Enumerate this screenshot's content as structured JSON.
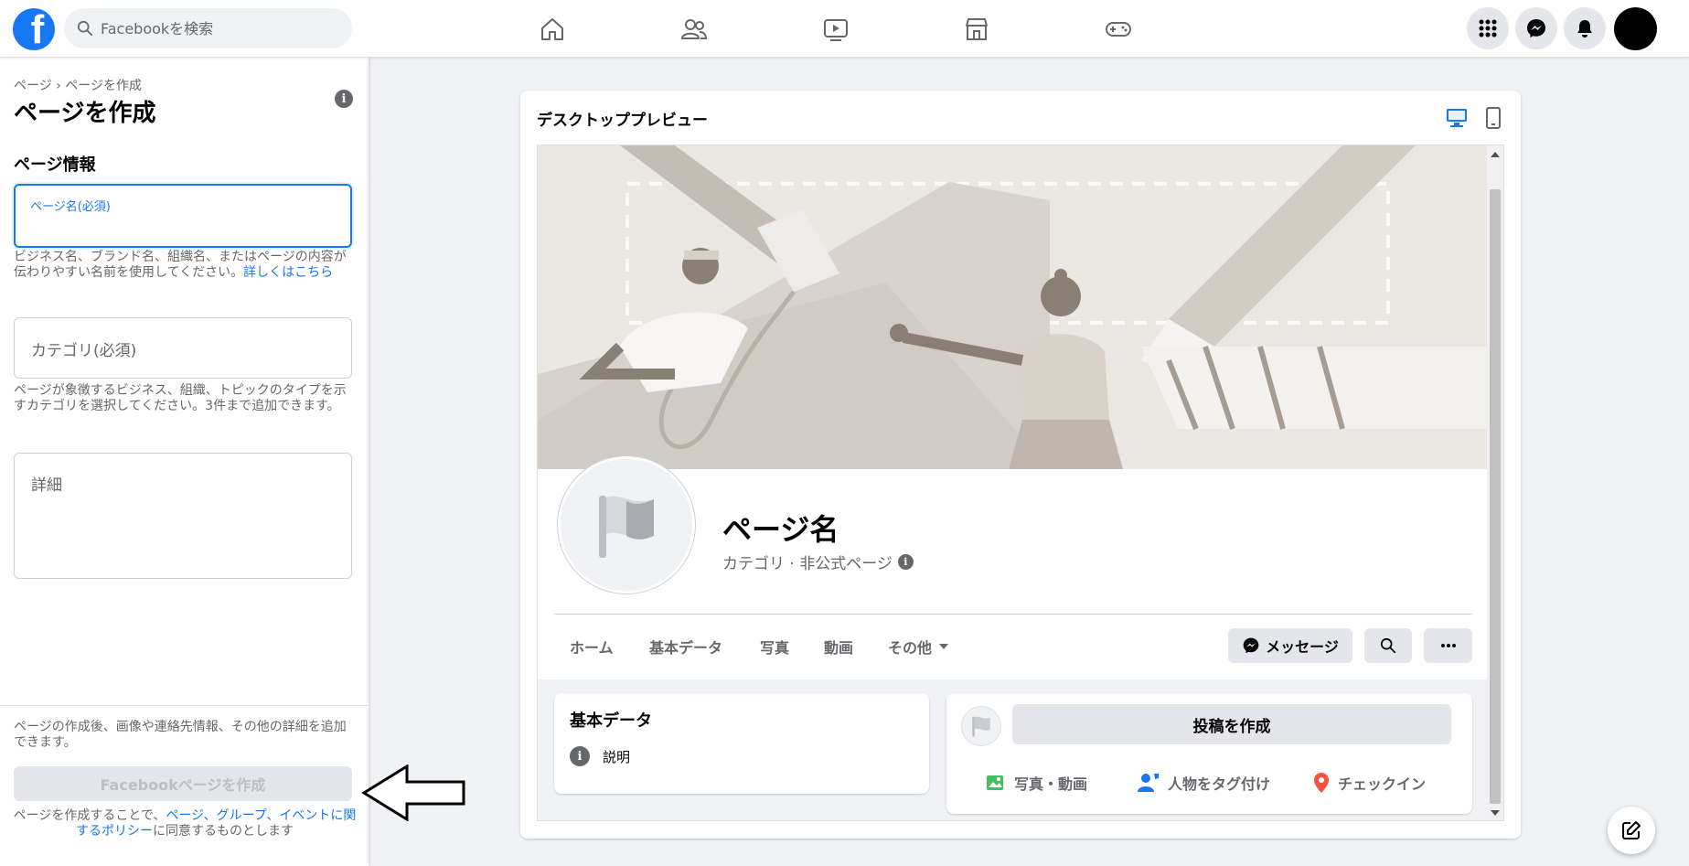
{
  "topbar": {
    "logo": "f",
    "search_placeholder": "Facebookを検索",
    "nav_icons": [
      "home-icon",
      "friends-icon",
      "watch-icon",
      "marketplace-icon",
      "gaming-icon"
    ],
    "right_icons": [
      "menu-grid-icon",
      "messenger-icon",
      "notifications-icon"
    ]
  },
  "left_panel": {
    "breadcrumb": "ページ › ページを作成",
    "title": "ページを作成",
    "section_title": "ページ情報",
    "name_field": {
      "label": "ページ名(必須)",
      "value": ""
    },
    "name_help": "ビジネス名、ブランド名、組織名、またはページの内容が伝わりやすい名前を使用してください。",
    "name_help_link": "詳しくはこちら",
    "category_field": {
      "placeholder": "カテゴリ(必須)"
    },
    "category_help": "ページが象徴するビジネス、組織、トピックのタイプを示すカテゴリを選択してください。3件まで追加できます。",
    "details_field": {
      "placeholder": "詳細"
    },
    "bottom_note": "ページの作成後、画像や連絡先情報、その他の詳細を追加できます。",
    "create_button": "Facebookページを作成",
    "policy_prefix": "ページを作成することで、",
    "policy_link": "ページ、グループ、イベントに関するポリシー",
    "policy_suffix": "に同意するものとします"
  },
  "preview": {
    "title": "デスクトッププレビュー",
    "page_name": "ページ名",
    "page_subtitle": "カテゴリ · 非公式ページ",
    "tabs": [
      "ホーム",
      "基本データ",
      "写真",
      "動画",
      "その他"
    ],
    "message_button": "メッセージ",
    "about_card": {
      "title": "基本データ",
      "item": "説明"
    },
    "post_card": {
      "create_post": "投稿を作成",
      "actions": [
        "写真・動画",
        "人物をタグ付け",
        "チェックイン"
      ]
    }
  },
  "colors": {
    "brand": "#1877f2",
    "background": "#f0f2f5",
    "secondary_text": "#65676b"
  }
}
